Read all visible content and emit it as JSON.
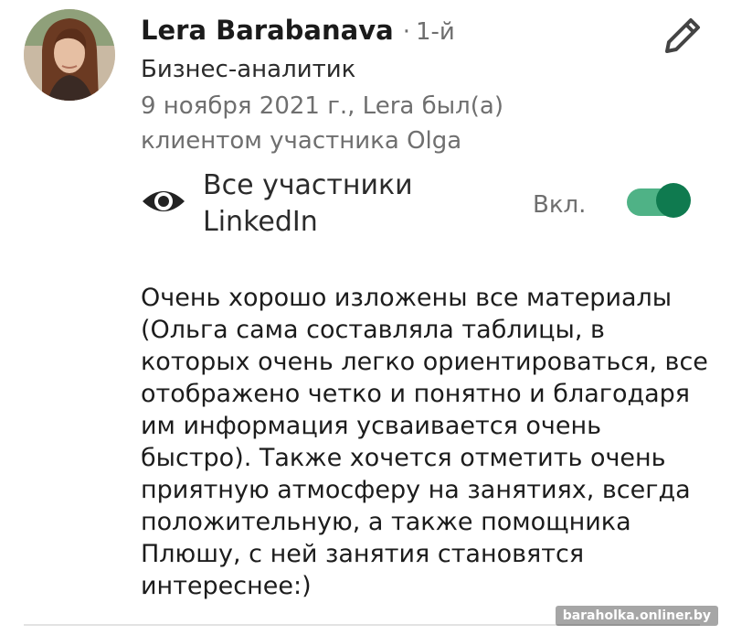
{
  "profile": {
    "name": "Lera Barabanava",
    "separator": "·",
    "degree": "1-й",
    "headline": "Бизнес-аналитик",
    "relation": "9 ноября 2021 г., Lera был(а) клиентом участника Olga"
  },
  "visibility": {
    "icon": "eye-icon",
    "label": "Все участники LinkedIn",
    "state_label": "Вкл.",
    "enabled": true
  },
  "actions": {
    "edit_icon": "pencil-icon"
  },
  "review": {
    "lines": [
      "Очень хорошо изложены все материалы",
      "(Ольга сама составляла таблицы, в",
      "которых очень легко ориентироваться, все",
      "отображено четко и понятно и благодаря",
      "им информация усваивается очень",
      "быстро). Также хочется отметить очень",
      "приятную атмосферу на занятиях, всегда",
      "положительную, а также помощника",
      "Плюшу, с ней занятия становятся",
      "интереснее:)"
    ]
  },
  "watermark": "baraholka.onliner.by",
  "colors": {
    "toggle_track": "#4fb286",
    "toggle_knob": "#0f7a4f",
    "primary_text": "#1b1b1b",
    "secondary_text": "#6f6f6f"
  }
}
